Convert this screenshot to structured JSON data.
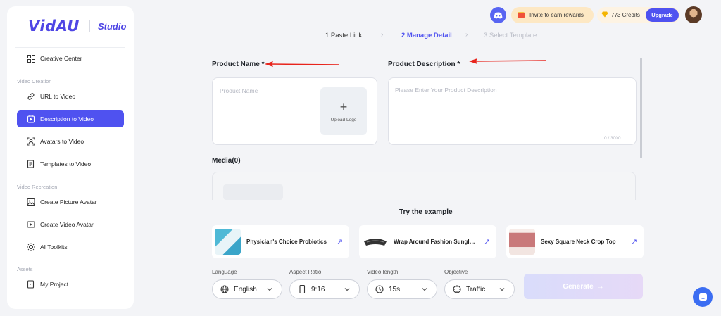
{
  "sidebar": {
    "logo": "VidAU",
    "studio": "Studio",
    "creative_center": "Creative Center",
    "sections": {
      "video_creation": "Video Creation",
      "video_recreation": "Video Recreation",
      "assets": "Assets"
    },
    "items": {
      "url_to_video": "URL to Video",
      "description_to_video": "Description to Video",
      "avatars_to_video": "Avatars to Video",
      "templates_to_video": "Templates to Video",
      "create_picture_avatar": "Create Picture Avatar",
      "create_video_avatar": "Create Video Avatar",
      "ai_toolkits": "AI Toolkits",
      "my_project": "My Project"
    },
    "active_item": "Description to Video"
  },
  "topbar": {
    "invite": "Invite to earn rewards",
    "credits": "773 Credits",
    "upgrade": "Upgrade"
  },
  "steps": [
    {
      "label": "1 Paste Link"
    },
    {
      "label": "2 Manage Detail"
    },
    {
      "label": "3 Select Template"
    }
  ],
  "form": {
    "product_name_label": "Product Name *",
    "product_name_placeholder": "Product Name",
    "upload_logo": "Upload Logo",
    "product_description_label": "Product Description *",
    "product_description_placeholder": "Please Enter Your Product Description",
    "char_count": "0 / 3000",
    "media_label": "Media(0)"
  },
  "examples": {
    "title": "Try the example",
    "items": [
      {
        "title": "Physician's Choice Probiotics"
      },
      {
        "title": "Wrap Around Fashion Sunglasses"
      },
      {
        "title": "Sexy Square Neck Crop Top"
      }
    ]
  },
  "controls": {
    "language_label": "Language",
    "language_value": "English",
    "aspect_label": "Aspect Ratio",
    "aspect_value": "9:16",
    "length_label": "Video length",
    "length_value": "15s",
    "objective_label": "Objective",
    "objective_value": "Traffic",
    "generate": "Generate"
  },
  "colors": {
    "accent": "#4f52f0",
    "annotation_arrow": "#e8241c"
  }
}
